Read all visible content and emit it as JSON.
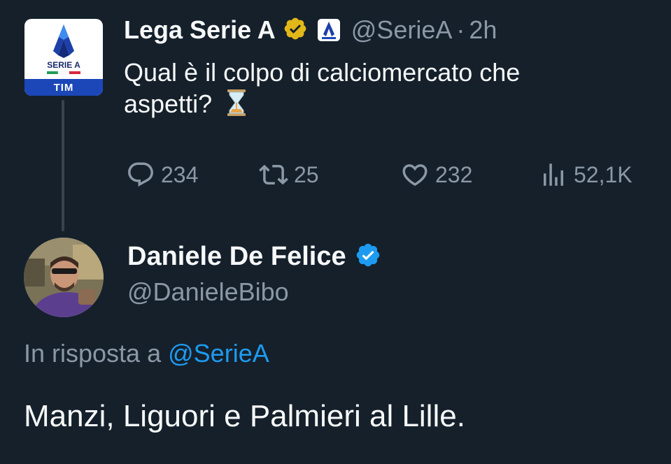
{
  "parent_tweet": {
    "display_name": "Lega Serie A",
    "handle": "@SerieA",
    "separator": "·",
    "time": "2h",
    "text_line1": "Qual è il colpo di calciomercato che",
    "text_line2": "aspetti?",
    "avatar": {
      "label": "SERIE A",
      "sponsor": "TIM"
    },
    "stats": {
      "replies": "234",
      "reposts": "25",
      "likes": "232",
      "views": "52,1K"
    }
  },
  "reply_tweet": {
    "display_name": "Daniele De Felice",
    "handle": "@DanieleBibo",
    "in_reply_prefix": "In risposta a",
    "in_reply_mention": "@SerieA",
    "text": "Manzi, Liguori e Palmieri al Lille."
  },
  "colors": {
    "background": "#15202b",
    "text_primary": "#f7f9f9",
    "text_secondary": "#8b98a5",
    "accent": "#1d9bf0",
    "gold_badge": "#e2b719"
  },
  "icons": {
    "reply": "reply-icon",
    "repost": "repost-icon",
    "like": "heart-icon",
    "views": "views-icon",
    "verified_gold": "verified-gold-icon",
    "verified_blue": "verified-blue-icon",
    "hourglass": "hourglass-icon"
  }
}
